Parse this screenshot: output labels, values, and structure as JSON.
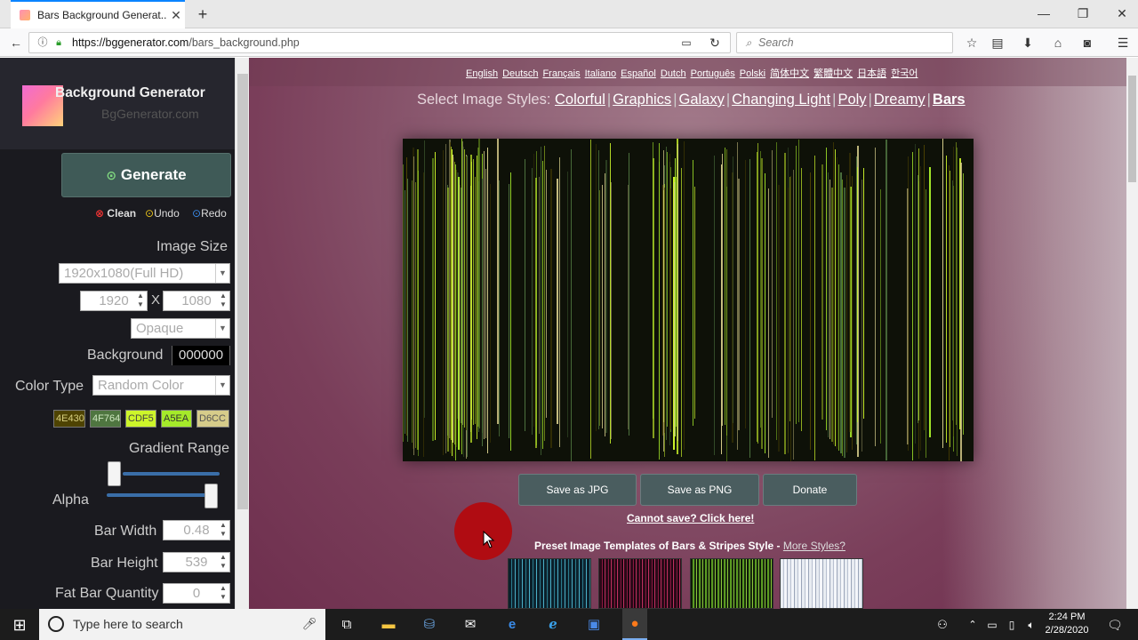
{
  "browser": {
    "tab_title": "Bars Background Generat...",
    "url_host": "https://bggenerator.com",
    "url_path": "/bars_background.php",
    "search_placeholder": "Search"
  },
  "sidebar": {
    "brand": "Background Generator",
    "brand_sub": "BgGenerator.com",
    "generate": "Generate",
    "clean": "Clean",
    "undo": "Undo",
    "redo": "Redo",
    "image_size_label": "Image Size",
    "image_size_value": "1920x1080(Full HD)",
    "width": "1920",
    "x_sep": "X",
    "height": "1080",
    "opacity_value": "Opaque",
    "background_label": "Background",
    "background_value": "000000",
    "color_type_label": "Color Type",
    "color_type_value": "Random Color",
    "colors": [
      {
        "label": "4E430",
        "bg": "#4e4302",
        "fg": "#d8d080"
      },
      {
        "label": "4F764",
        "bg": "#4f7640",
        "fg": "#cfe8c0"
      },
      {
        "label": "CDF5",
        "bg": "#cdf52a",
        "fg": "#444"
      },
      {
        "label": "A5EA",
        "bg": "#a5ea2a",
        "fg": "#333"
      },
      {
        "label": "D6CC",
        "bg": "#d6cc8a",
        "fg": "#555"
      }
    ],
    "gradient_range_label": "Gradient Range",
    "alpha_label": "Alpha",
    "bar_width_label": "Bar Width",
    "bar_width_value": "0.48",
    "bar_height_label": "Bar Height",
    "bar_height_value": "539",
    "fat_bar_label": "Fat Bar Quantity",
    "fat_bar_value": "0"
  },
  "main": {
    "languages": [
      "English",
      "Deutsch",
      "Français",
      "Italiano",
      "Español",
      "Dutch",
      "Português",
      "Polski",
      "简体中文",
      "繁體中文",
      "日本語",
      "한국어"
    ],
    "styles_prefix": "Select Image Styles:",
    "styles": [
      "Colorful",
      "Graphics",
      "Galaxy",
      "Changing Light",
      "Poly",
      "Dreamy",
      "Bars"
    ],
    "save_jpg": "Save as JPG",
    "save_png": "Save as PNG",
    "donate": "Donate",
    "cannot_save": "Cannot save? Click here!",
    "preset_title": "Preset Image Templates of Bars & Stripes Style",
    "preset_sep": " - ",
    "more_styles": "More Styles?"
  },
  "taskbar": {
    "search_placeholder": "Type here to search",
    "time": "2:24 PM",
    "date": "2/28/2020"
  }
}
